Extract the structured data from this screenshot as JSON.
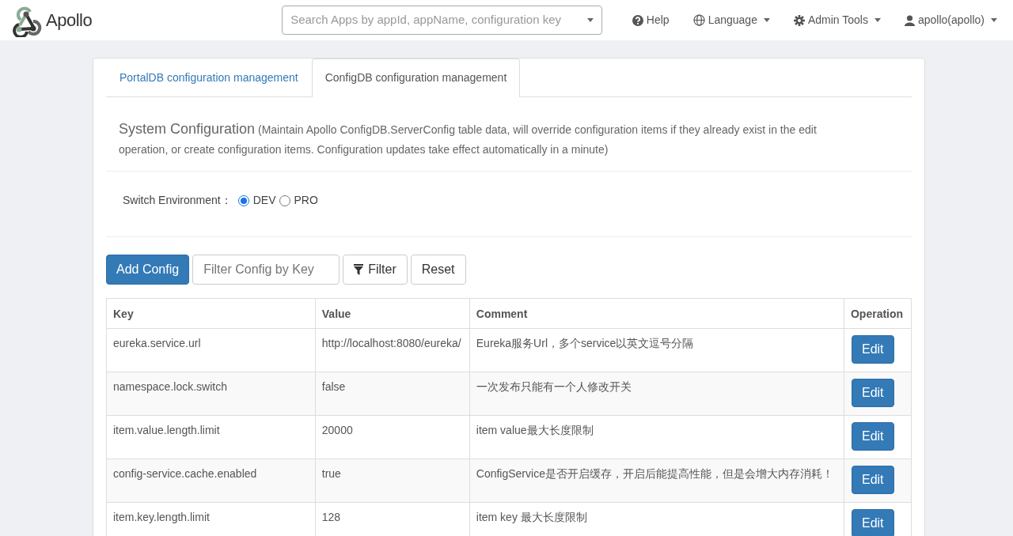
{
  "brand": "Apollo",
  "search": {
    "placeholder": "Search Apps by appId, appName, configuration key"
  },
  "nav": [
    {
      "label": "Help",
      "kind": "help",
      "dropdown": false
    },
    {
      "label": "Language",
      "kind": "globe",
      "dropdown": true
    },
    {
      "label": "Admin Tools",
      "kind": "gear",
      "dropdown": true
    },
    {
      "label": "apollo(apollo)",
      "kind": "user",
      "dropdown": true
    }
  ],
  "tabs": [
    {
      "label": "PortalDB configuration management",
      "selected": false
    },
    {
      "label": "ConfigDB configuration management",
      "selected": true
    }
  ],
  "section": {
    "title": "System Configuration",
    "description": "(Maintain Apollo ConfigDB.ServerConfig table data, will override configuration items if they already exist in the edit operation, or create configuration items. Configuration updates take effect automatically in a minute)"
  },
  "environment": {
    "label": "Switch Environment：",
    "options": [
      {
        "label": "DEV",
        "selected": true
      },
      {
        "label": "PRO",
        "selected": false
      }
    ]
  },
  "toolbar": {
    "add": "Add Config",
    "filter_placeholder": "Filter Config by Key",
    "filter": "Filter",
    "reset": "Reset"
  },
  "table": {
    "columns": [
      "Key",
      "Value",
      "Comment",
      "Operation"
    ],
    "rows": [
      {
        "key": "eureka.service.url",
        "value": "http://localhost:8080/eureka/",
        "comment": "Eureka服务Url，多个service以英文逗号分隔",
        "action": "Edit"
      },
      {
        "key": "namespace.lock.switch",
        "value": "false",
        "comment": "一次发布只能有一个人修改开关",
        "action": "Edit"
      },
      {
        "key": "item.value.length.limit",
        "value": "20000",
        "comment": "item value最大长度限制",
        "action": "Edit"
      },
      {
        "key": "config-service.cache.enabled",
        "value": "true",
        "comment": "ConfigService是否开启缓存，开启后能提高性能，但是会增大内存消耗！",
        "action": "Edit"
      },
      {
        "key": "item.key.length.limit",
        "value": "128",
        "comment": "item key 最大长度限制",
        "action": "Edit"
      }
    ]
  }
}
